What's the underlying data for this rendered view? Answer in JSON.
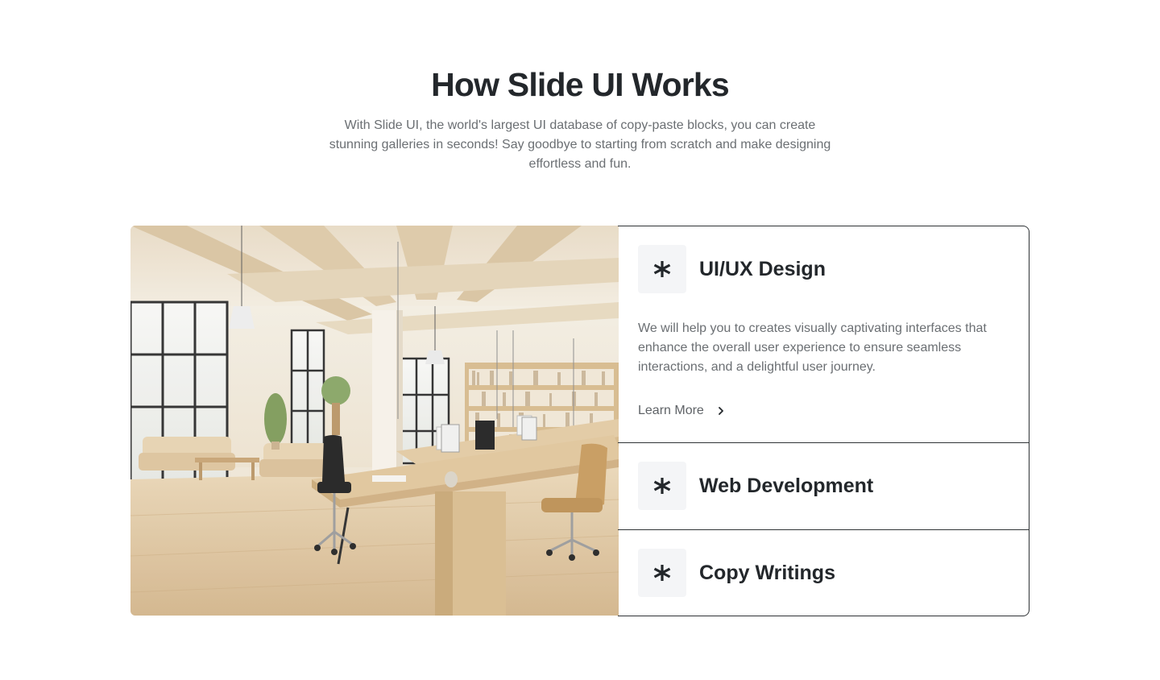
{
  "section": {
    "title": "How Slide UI Works",
    "subtitle": "With Slide UI, the world's largest UI database of copy-paste blocks, you can create stunning galleries in seconds! Say goodbye to starting from scratch and make designing effortless and fun."
  },
  "accordion": {
    "items": [
      {
        "icon": "asterisk-icon",
        "title": "UI/UX Design",
        "expanded": true,
        "description": "We will help you to creates visually captivating interfaces that enhance the overall user experience to ensure seamless interactions, and a delightful user journey.",
        "link_label": "Learn More"
      },
      {
        "icon": "asterisk-icon",
        "title": "Web Development",
        "expanded": false
      },
      {
        "icon": "asterisk-icon",
        "title": "Copy Writings",
        "expanded": false
      }
    ]
  },
  "colors": {
    "heading": "#23272b",
    "muted_text": "#6b6f73",
    "border": "#2f3336",
    "icon_bg": "#f4f5f7"
  }
}
